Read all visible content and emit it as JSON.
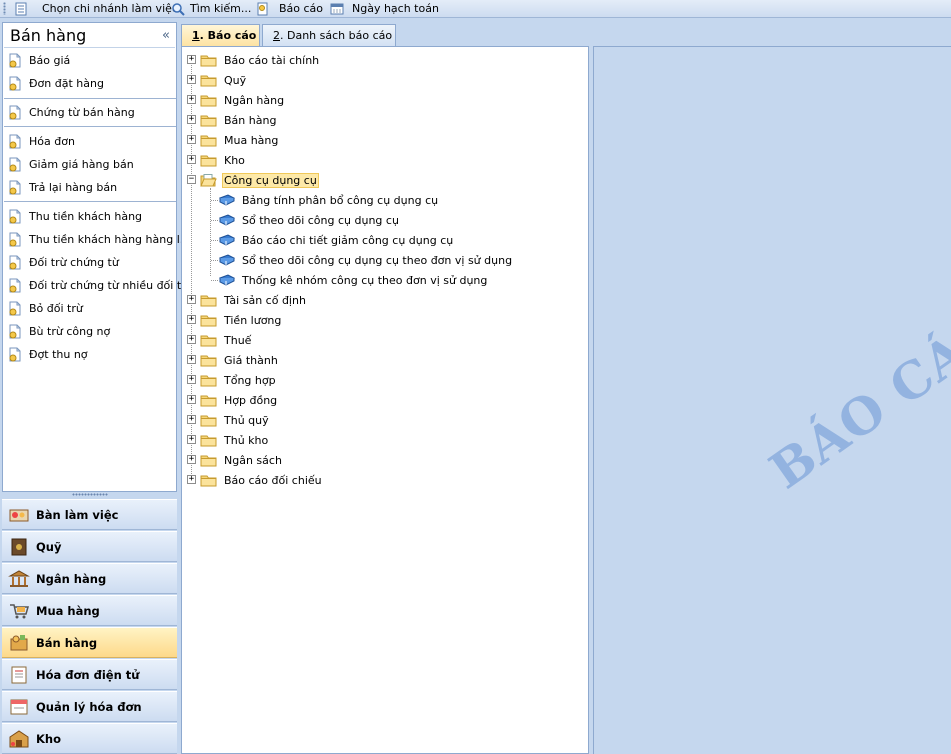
{
  "toolbar": {
    "items": [
      {
        "label": "Chọn chi nhánh làm việc",
        "icon": "branch-doc-icon"
      },
      {
        "label": "Tìm kiếm...",
        "icon": "search-icon"
      },
      {
        "label": "Báo cáo",
        "icon": "report-icon"
      },
      {
        "label": "Ngày hạch toán",
        "icon": "calendar-icon"
      }
    ]
  },
  "left_panel": {
    "title": "Bán hàng",
    "collapse_glyph": "«",
    "items": [
      "Báo giá",
      "Đơn đặt hàng",
      "Chứng từ bán hàng",
      "Hóa đơn",
      "Giảm giá hàng bán",
      "Trả lại hàng bán",
      "Thu tiền khách hàng",
      "Thu tiền khách hàng hàng l...",
      "Đối trừ chứng từ",
      "Đối trừ chứng từ nhiều đối t...",
      "Bỏ đối trừ",
      "Bù trừ công nợ",
      "Đợt thu nợ"
    ]
  },
  "modules": {
    "active": "Bán hàng",
    "items": [
      {
        "label": "Bàn làm việc",
        "icon": "desk-icon"
      },
      {
        "label": "Quỹ",
        "icon": "safe-icon"
      },
      {
        "label": "Ngân hàng",
        "icon": "bank-icon"
      },
      {
        "label": "Mua hàng",
        "icon": "purchase-icon"
      },
      {
        "label": "Bán hàng",
        "icon": "sales-icon"
      },
      {
        "label": "Hóa đơn điện tử",
        "icon": "e-invoice-icon"
      },
      {
        "label": "Quản lý hóa đơn",
        "icon": "invoice-manage-icon"
      },
      {
        "label": "Kho",
        "icon": "warehouse-icon"
      }
    ]
  },
  "tabs": [
    {
      "key": "1",
      "label": ". Báo cáo",
      "active": true
    },
    {
      "key": "2",
      "label": ". Danh sách báo cáo",
      "active": false
    }
  ],
  "tree": {
    "folders_before": [
      "Báo cáo tài chính",
      "Quỹ",
      "Ngân hàng",
      "Bán hàng",
      "Mua hàng",
      "Kho"
    ],
    "expanded_folder": "Công cụ dụng cụ",
    "reports": [
      "Bảng tính phân bổ công cụ dụng cụ",
      "Sổ theo dõi công cụ dụng cụ",
      "Báo cáo chi tiết giảm công cụ dụng cụ",
      "Sổ theo dõi công cụ dụng cụ theo đơn vị sử dụng",
      "Thống kê nhóm công cụ theo đơn vị sử dụng"
    ],
    "folders_after": [
      "Tài sản cố định",
      "Tiền lương",
      "Thuế",
      "Giá thành",
      "Tổng hợp",
      "Hợp đồng",
      "Thủ quỹ",
      "Thủ kho",
      "Ngân sách",
      "Báo cáo đối chiếu"
    ]
  },
  "watermark": "BÁO CÁO",
  "colors": {
    "background": "#c5d7ee",
    "active_highlight": "#fdd98a",
    "selection": "#fde9a8",
    "watermark": "#93b3e0"
  }
}
